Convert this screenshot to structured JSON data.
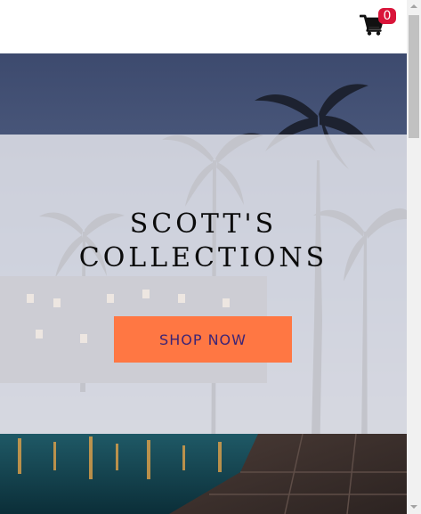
{
  "header": {
    "cart_count": "0",
    "cart_icon": "shopping-cart-icon"
  },
  "hero": {
    "title": "SCOTT'S\nCOLLECTIONS",
    "button_label": "SHOP NOW",
    "background": "tropical-resort-pool-palms-dusk-photo"
  },
  "colors": {
    "accent_button": "#ff7743",
    "button_text": "#3d2476",
    "cart_badge": "#d9153a"
  }
}
